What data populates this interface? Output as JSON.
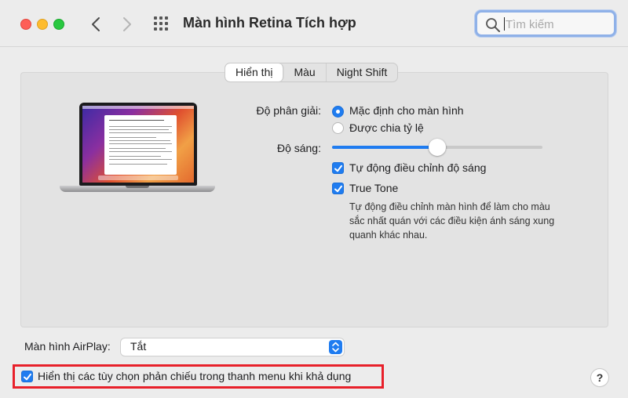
{
  "window": {
    "title": "Màn hình Retina Tích hợp"
  },
  "toolbar": {
    "back_icon": "chevron-left-icon",
    "forward_icon": "chevron-right-icon",
    "grid_icon": "grid-icon",
    "search": {
      "placeholder": "Tìm kiếm",
      "value": ""
    }
  },
  "tabs": [
    {
      "label": "Hiển thị",
      "active": true
    },
    {
      "label": "Màu",
      "active": false
    },
    {
      "label": "Night Shift",
      "active": false
    }
  ],
  "display": {
    "resolution_label": "Độ phân giải:",
    "resolution_options": [
      {
        "label": "Mặc định cho màn hình",
        "selected": true
      },
      {
        "label": "Được chia tỷ lệ",
        "selected": false
      }
    ],
    "brightness_label": "Độ sáng:",
    "brightness_level": 0.5,
    "auto_brightness": {
      "label": "Tự động điều chỉnh độ sáng",
      "checked": true
    },
    "true_tone": {
      "label": "True Tone",
      "checked": true,
      "description": "Tự động điều chỉnh màn hình để làm cho màu sắc nhất quán với các điều kiện ánh sáng xung quanh khác nhau."
    }
  },
  "airplay": {
    "label": "Màn hình AirPlay:",
    "selected": "Tắt"
  },
  "mirroring": {
    "label": "Hiển thị các tùy chọn phản chiếu trong thanh menu khi khả dụng",
    "checked": true
  },
  "help_label": "?",
  "colors": {
    "accent": "#1f7cf0",
    "highlight_border": "#e8202a"
  }
}
